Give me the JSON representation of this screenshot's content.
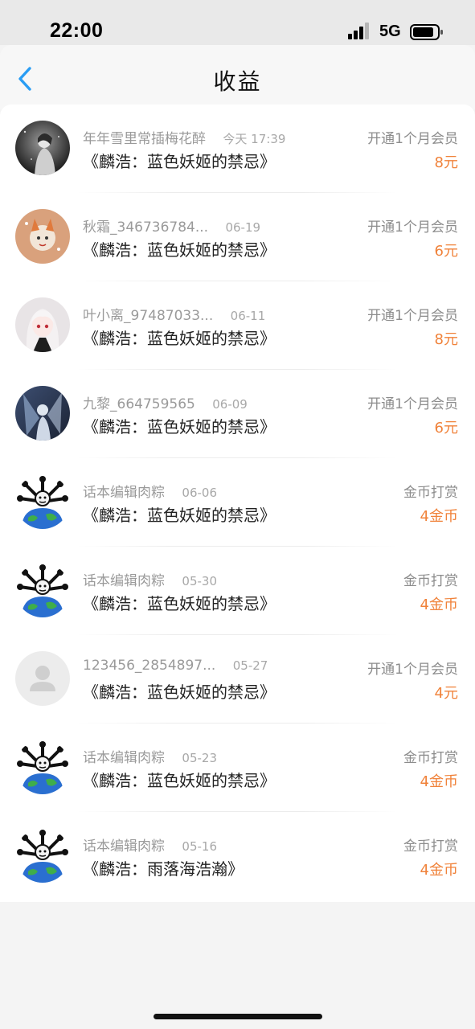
{
  "status": {
    "time": "22:00",
    "network": "5G"
  },
  "header": {
    "title": "收益"
  },
  "colors": {
    "accent": "#2a9df4",
    "amount": "#f0823a",
    "muted": "#9a9a9a"
  },
  "items": [
    {
      "avatar": "avatar-dark-art",
      "user": "年年雪里常插梅花醉",
      "date": "今天 17:39",
      "work": "《麟浩：蓝色妖姬的禁忌》",
      "event": "开通1个月会员",
      "amount": "8元"
    },
    {
      "avatar": "avatar-fox-illustration",
      "user": "秋霜_346736784...",
      "date": "06-19",
      "work": "《麟浩：蓝色妖姬的禁忌》",
      "event": "开通1个月会员",
      "amount": "6元"
    },
    {
      "avatar": "avatar-anime-girl",
      "user": "叶小离_97487033...",
      "date": "06-11",
      "work": "《麟浩：蓝色妖姬的禁忌》",
      "event": "开通1个月会员",
      "amount": "8元"
    },
    {
      "avatar": "avatar-fantasy-art",
      "user": "九黎_664759565",
      "date": "06-09",
      "work": "《麟浩：蓝色妖姬的禁忌》",
      "event": "开通1个月会员",
      "amount": "6元"
    },
    {
      "avatar": "avatar-globe-meme",
      "user": "话本编辑肉粽",
      "date": "06-06",
      "work": "《麟浩：蓝色妖姬的禁忌》",
      "event": "金币打赏",
      "amount": "4金币"
    },
    {
      "avatar": "avatar-globe-meme",
      "user": "话本编辑肉粽",
      "date": "05-30",
      "work": "《麟浩：蓝色妖姬的禁忌》",
      "event": "金币打赏",
      "amount": "4金币"
    },
    {
      "avatar": "avatar-default-person",
      "user": "123456_2854897...",
      "date": "05-27",
      "work": "《麟浩：蓝色妖姬的禁忌》",
      "event": "开通1个月会员",
      "amount": "4元"
    },
    {
      "avatar": "avatar-globe-meme",
      "user": "话本编辑肉粽",
      "date": "05-23",
      "work": "《麟浩：蓝色妖姬的禁忌》",
      "event": "金币打赏",
      "amount": "4金币"
    },
    {
      "avatar": "avatar-globe-meme",
      "user": "话本编辑肉粽",
      "date": "05-16",
      "work": "《麟浩：雨落海浩瀚》",
      "event": "金币打赏",
      "amount": "4金币"
    }
  ]
}
